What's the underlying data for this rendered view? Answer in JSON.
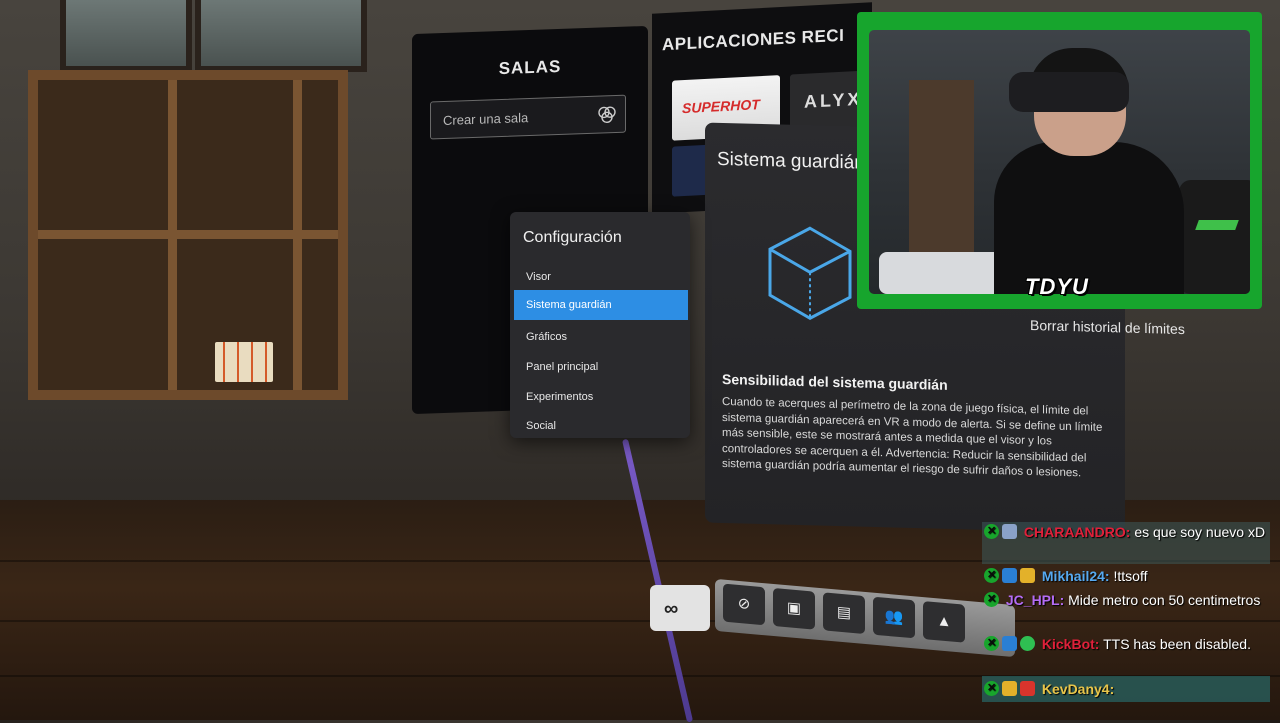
{
  "salas": {
    "title": "SALAS",
    "input_placeholder": "Crear una sala"
  },
  "apps": {
    "title": "APLICACIONES RECI",
    "tiles": [
      {
        "label": "SUPERHOT"
      },
      {
        "label": "ALYX"
      }
    ]
  },
  "guardian_panel": {
    "title": "Sistema guardián",
    "clear_history": "Borrar historial de límites",
    "sensitivity_title": "Sensibilidad del sistema guardián",
    "sensitivity_desc": "Cuando te acerques al perímetro de la zona de juego física, el límite del sistema guardián aparecerá en VR a modo de alerta. Si se define un límite más sensible, este se mostrará antes a medida que el visor y los controladores se acerquen a él. Advertencia: Reducir la sensibilidad del sistema guardián podría aumentar el riesgo de sufrir daños o lesiones."
  },
  "config_menu": {
    "title": "Configuración",
    "items": [
      {
        "label": "Visor"
      },
      {
        "label": "Sistema guardián",
        "active": true
      },
      {
        "label": "Gráficos"
      },
      {
        "label": "Panel principal"
      },
      {
        "label": "Experimentos"
      },
      {
        "label": "Social"
      }
    ]
  },
  "dock": {
    "logo": "∞",
    "buttons": [
      {
        "icon": "compass-icon",
        "glyph": "⊘"
      },
      {
        "icon": "library-icon",
        "glyph": "▣"
      },
      {
        "icon": "store-icon",
        "glyph": "▤"
      },
      {
        "icon": "people-icon",
        "glyph": "👥"
      },
      {
        "icon": "notifications-icon",
        "glyph": "▲"
      }
    ]
  },
  "webcam": {
    "name": "TDYU",
    "border_color": "#17a52d"
  },
  "chat": {
    "messages": [
      {
        "user": "CHARAANDRO:",
        "user_color": "#e0203a",
        "text": "es que soy nuevo xD"
      },
      {
        "user": "Mikhail24:",
        "user_color": "#56a9f0",
        "text": "!ttsoff"
      },
      {
        "user": "JC_HPL:",
        "user_color": "#b46cf4",
        "text": "Mide metro con 50 centimetros"
      },
      {
        "user": "KickBot:",
        "user_color": "#e0203a",
        "text": "TTS has been disabled."
      },
      {
        "user": "KevDany4:",
        "user_color": "#e8c54a",
        "text": ""
      }
    ]
  }
}
